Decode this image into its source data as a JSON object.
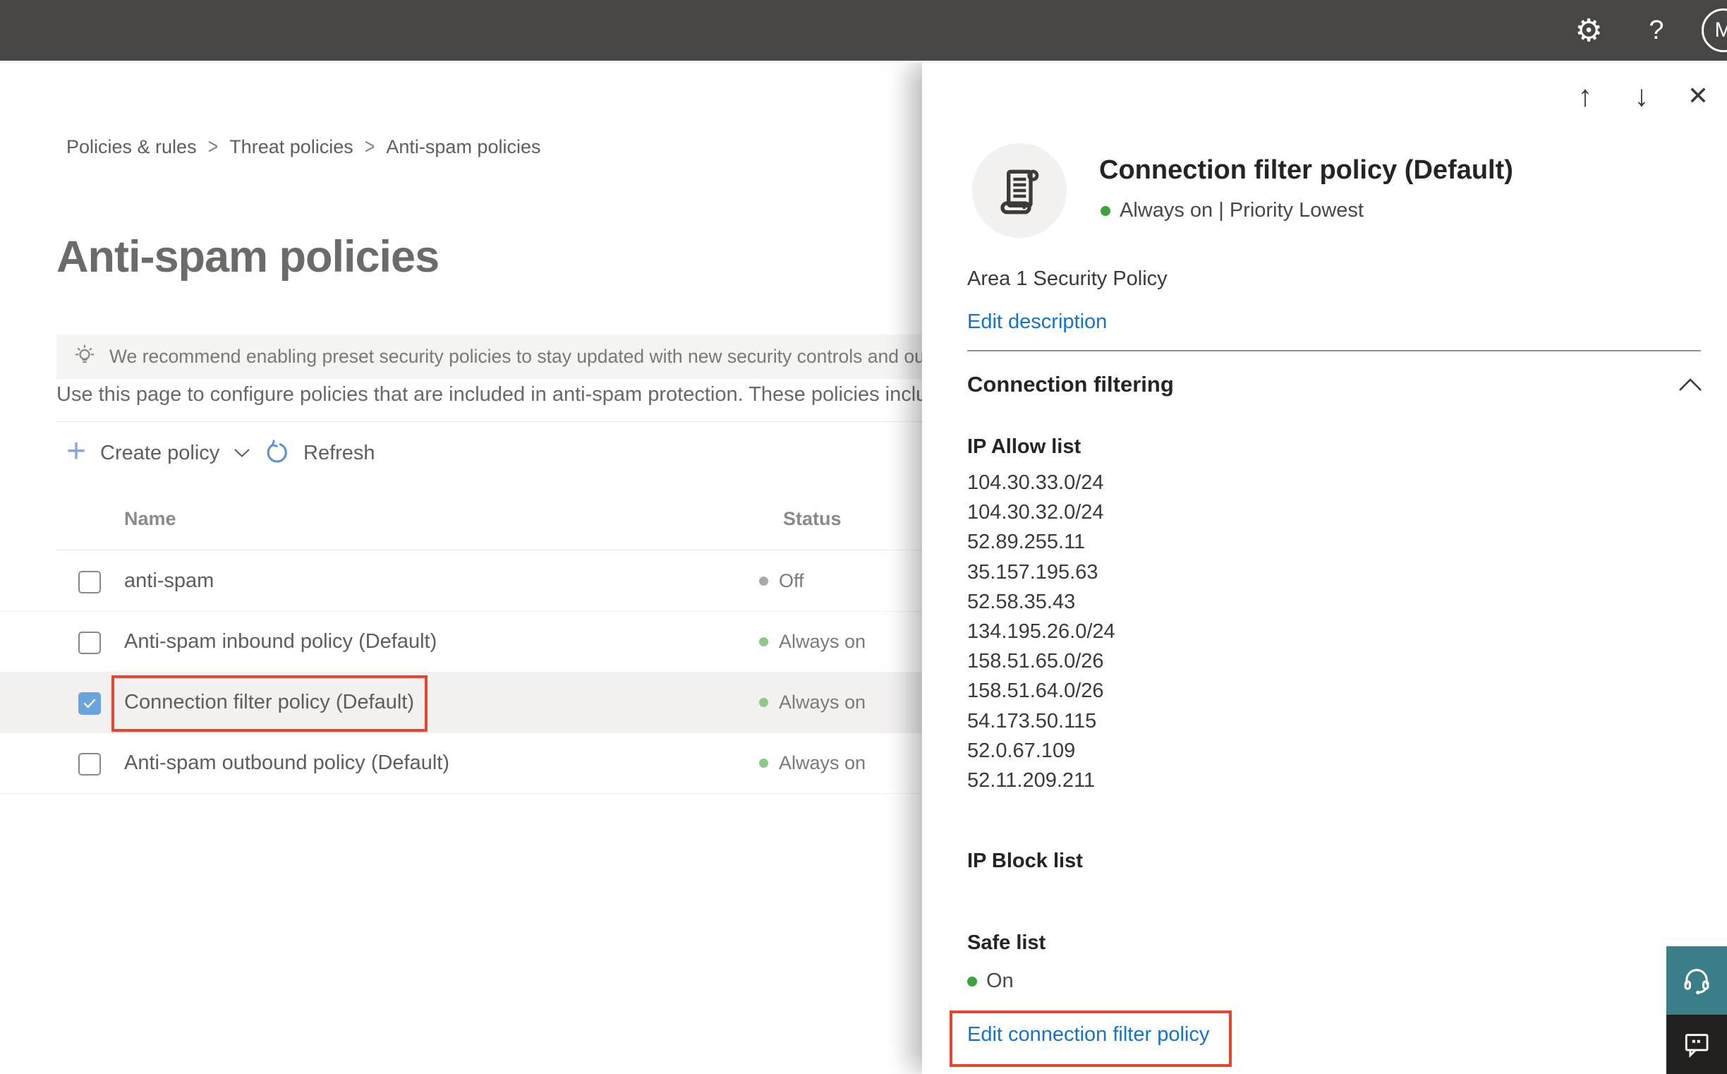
{
  "topbar": {
    "icons": {
      "gear": "⚙",
      "help": "?"
    },
    "avatar_initial": "M"
  },
  "breadcrumb": {
    "separator": ">",
    "items": [
      {
        "label": "Policies & rules"
      },
      {
        "label": "Threat policies"
      },
      {
        "label": "Anti-spam policies"
      }
    ]
  },
  "page": {
    "title": "Anti-spam policies",
    "banner_text": "We recommend enabling preset security policies to stay updated with new security controls and our recomme",
    "description": "Use this page to configure policies that are included in anti-spam protection. These policies include"
  },
  "toolbar": {
    "plus_glyph": "+",
    "create_label": "Create policy",
    "refresh_label": "Refresh"
  },
  "table": {
    "columns": [
      {
        "label": "Name"
      },
      {
        "label": "Status"
      }
    ],
    "rows": [
      {
        "name": "anti-spam",
        "status": "Off",
        "state": "off",
        "checked": false
      },
      {
        "name": "Anti-spam inbound policy (Default)",
        "status": "Always on",
        "state": "on",
        "checked": false
      },
      {
        "name": "Connection filter policy (Default)",
        "status": "Always on",
        "state": "on",
        "checked": true,
        "highlighted": true
      },
      {
        "name": "Anti-spam outbound policy (Default)",
        "status": "Always on",
        "state": "on",
        "checked": false
      }
    ]
  },
  "panel": {
    "nav": {
      "up": "↑",
      "down": "↓",
      "close": "✕"
    },
    "title": "Connection filter policy (Default)",
    "status_line": "Always on | Priority Lowest",
    "description": "Area 1 Security Policy",
    "edit_description_label": "Edit description",
    "section_title": "Connection filtering",
    "ip_allow": {
      "heading": "IP Allow list",
      "items": [
        "104.30.33.0/24",
        "104.30.32.0/24",
        "52.89.255.11",
        "35.157.195.63",
        "52.58.35.43",
        "134.195.26.0/24",
        "158.51.65.0/26",
        "158.51.64.0/26",
        "54.173.50.115",
        "52.0.67.109",
        "52.11.209.211"
      ]
    },
    "ip_block": {
      "heading": "IP Block list"
    },
    "safe_list": {
      "heading": "Safe list",
      "status": "On"
    },
    "edit_link_label": "Edit connection filter policy"
  },
  "colors": {
    "topbar_bg": "#484644",
    "link_blue": "#1673c9",
    "checkbox_blue": "#6ba3dc",
    "toolbar_plus_blue": "#84aadb",
    "refresh_blue": "#5b91d6",
    "status_green_soft": "#8cc88b",
    "status_green_bright": "#3aa33a",
    "status_gray_off": "#a9a9a9",
    "annotation_red": "#e8442e",
    "support_teal": "#3a7e87",
    "feedback_dark": "#232120",
    "row_highlight": "#f2f1f0"
  }
}
